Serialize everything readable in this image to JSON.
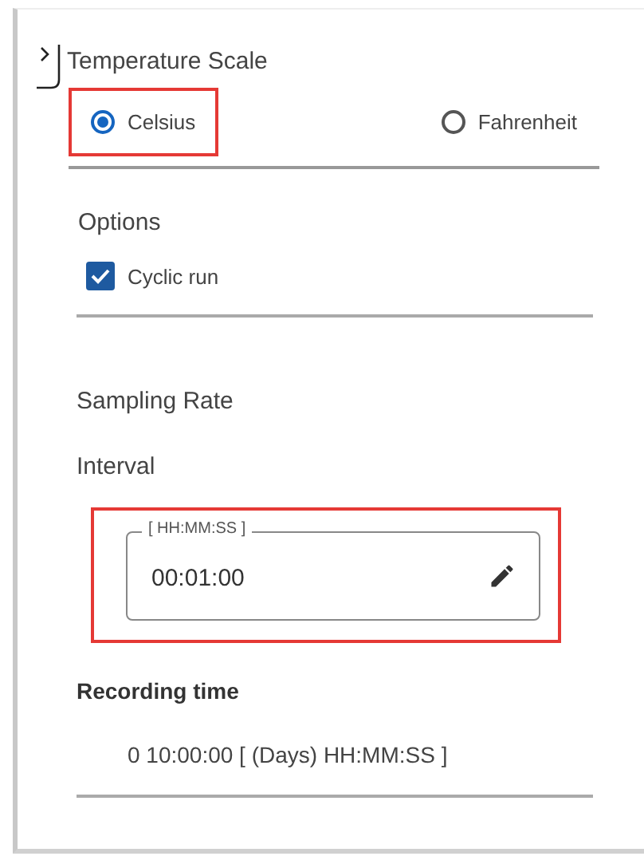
{
  "temperature_scale": {
    "title": "Temperature Scale",
    "options": [
      {
        "label": "Celsius",
        "selected": true,
        "highlighted": true
      },
      {
        "label": "Fahrenheit",
        "selected": false,
        "highlighted": false
      }
    ]
  },
  "options": {
    "title": "Options",
    "checkboxes": [
      {
        "label": "Cyclic run",
        "checked": true
      }
    ]
  },
  "sampling_rate": {
    "title": "Sampling Rate",
    "interval_label": "Interval",
    "interval_field": {
      "legend": "[ HH:MM:SS ]",
      "value": "00:01:00",
      "highlighted": true
    }
  },
  "recording_time": {
    "title": "Recording time",
    "value": "0 10:00:00 [ (Days) HH:MM:SS ]"
  }
}
